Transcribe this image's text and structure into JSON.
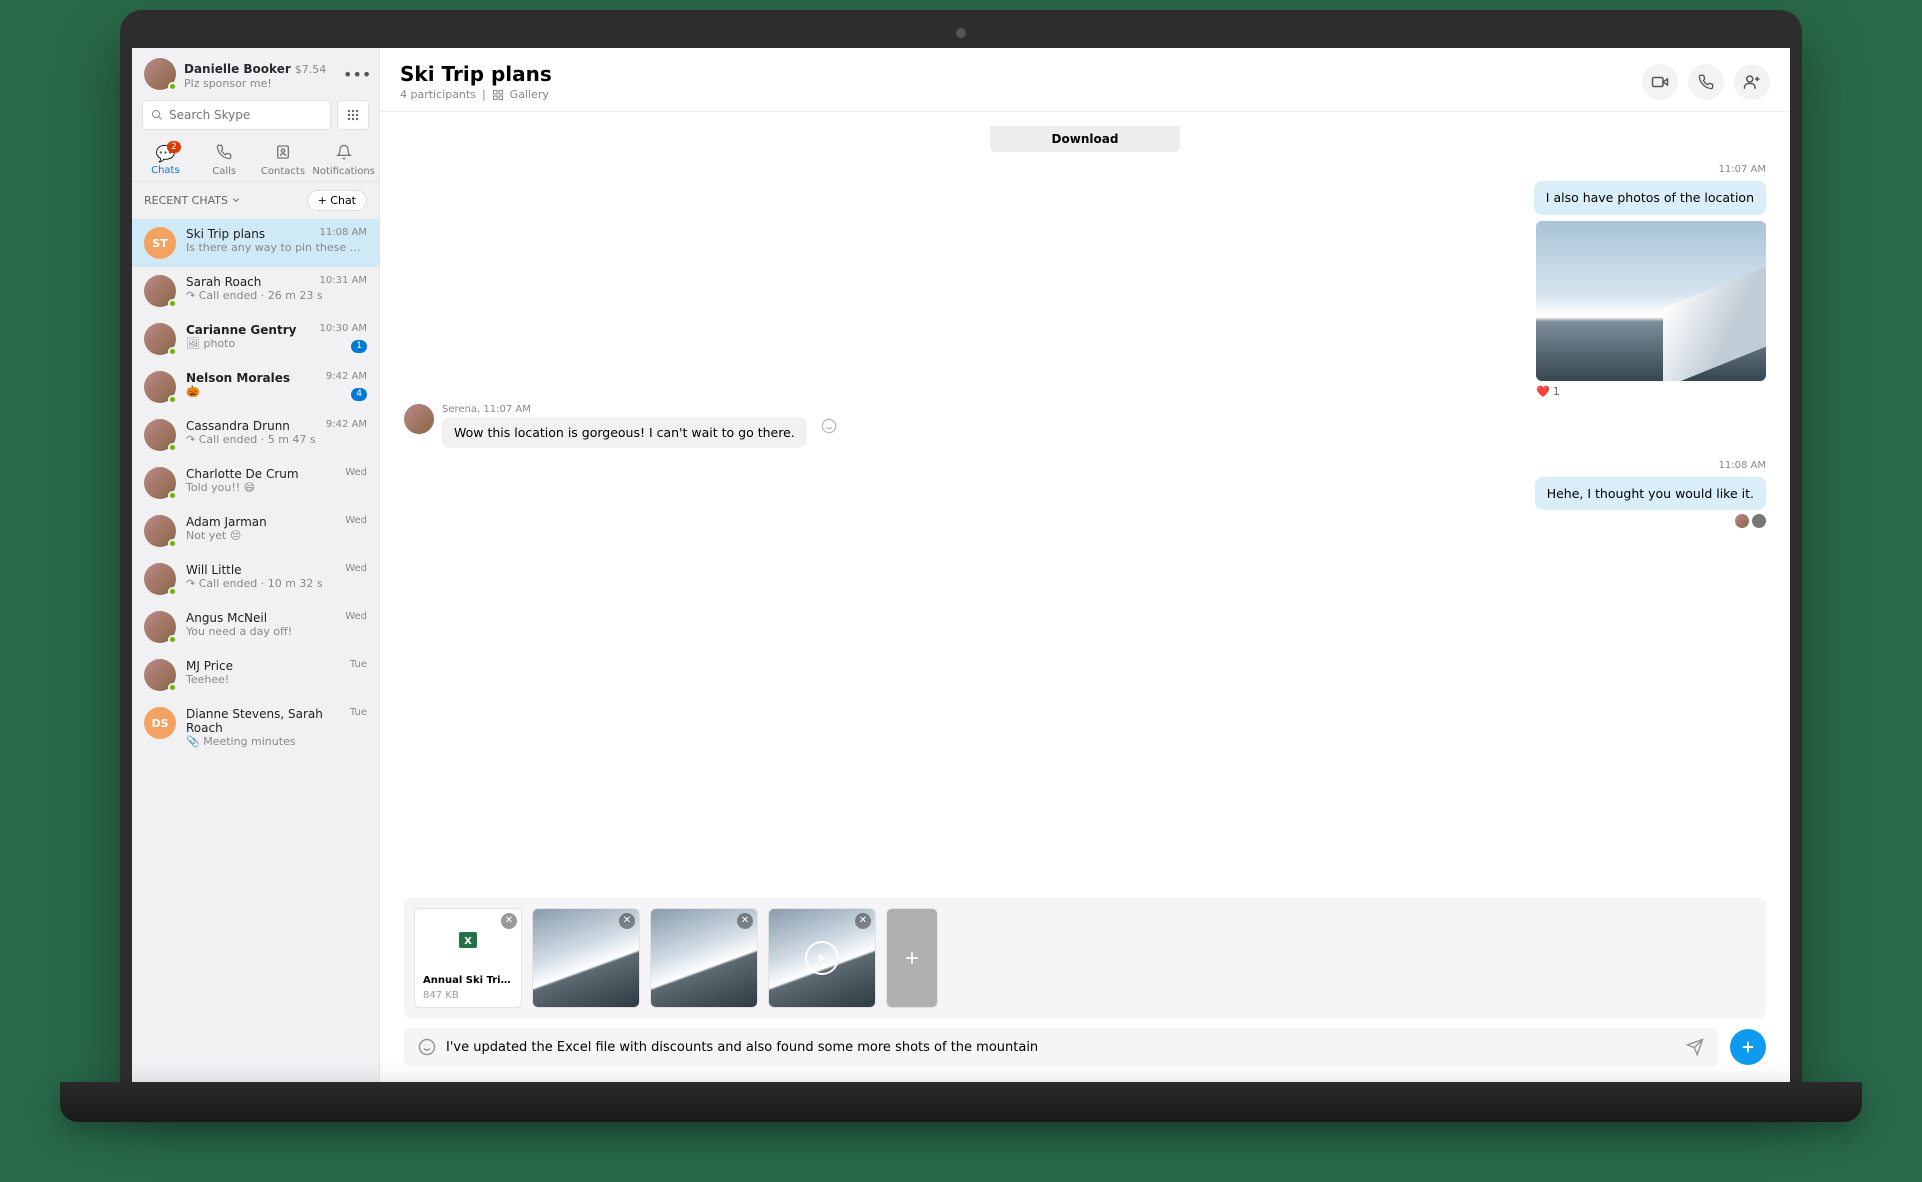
{
  "profile": {
    "name": "Danielle Booker",
    "credit": "$7.54",
    "status": "Plz sponsor me!"
  },
  "search": {
    "placeholder": "Search Skype"
  },
  "nav": {
    "chats": "Chats",
    "chats_badge": "2",
    "calls": "Calls",
    "contacts": "Contacts",
    "notifications": "Notifications"
  },
  "section": {
    "recent": "RECENT CHATS",
    "new_chat": "+ Chat"
  },
  "chats": [
    {
      "initials": "ST",
      "title": "Ski Trip plans",
      "preview": "Is there any way to pin these …",
      "time": "11:08 AM",
      "active": true
    },
    {
      "title": "Sarah Roach",
      "preview": "↷ Call ended · 26 m 23 s",
      "time": "10:31 AM"
    },
    {
      "title": "Carianne Gentry",
      "preview": "🖼 photo",
      "time": "10:30 AM",
      "unread": true,
      "badge": "1"
    },
    {
      "title": "Nelson Morales",
      "preview": "🎃",
      "time": "9:42 AM",
      "unread": true,
      "badge": "4"
    },
    {
      "title": "Cassandra Drunn",
      "preview": "↷ Call ended · 5 m 47 s",
      "time": "9:42 AM"
    },
    {
      "title": "Charlotte De Crum",
      "preview": "Told you!! 😄",
      "time": "Wed"
    },
    {
      "title": "Adam Jarman",
      "preview": "Not yet 😔",
      "time": "Wed"
    },
    {
      "title": "Will Little",
      "preview": "↷ Call ended · 10 m 32 s",
      "time": "Wed"
    },
    {
      "title": "Angus McNeil",
      "preview": "You need a day off!",
      "time": "Wed"
    },
    {
      "title": "MJ Price",
      "preview": "Teehee!",
      "time": "Tue"
    },
    {
      "initials": "DS",
      "title": "Dianne Stevens, Sarah Roach",
      "preview": "📎 Meeting minutes",
      "time": "Tue"
    }
  ],
  "conversation": {
    "title": "Ski Trip plans",
    "subtitle_participants": "4 participants",
    "subtitle_gallery": "Gallery",
    "download": "Download",
    "time1": "11:07 AM",
    "msg1": "I also have photos of the location",
    "reaction1_count": "1",
    "in_from": "Serena, 11:07 AM",
    "in_text": "Wow this location is gorgeous! I can't wait to go there.",
    "time2": "11:08 AM",
    "msg2": "Hehe, I thought you would like it."
  },
  "attachments": {
    "file_name": "Annual Ski Trip...",
    "file_size": "847 KB"
  },
  "composer": {
    "text": "I've updated the Excel file with discounts and also found some more shots of the mountain"
  }
}
